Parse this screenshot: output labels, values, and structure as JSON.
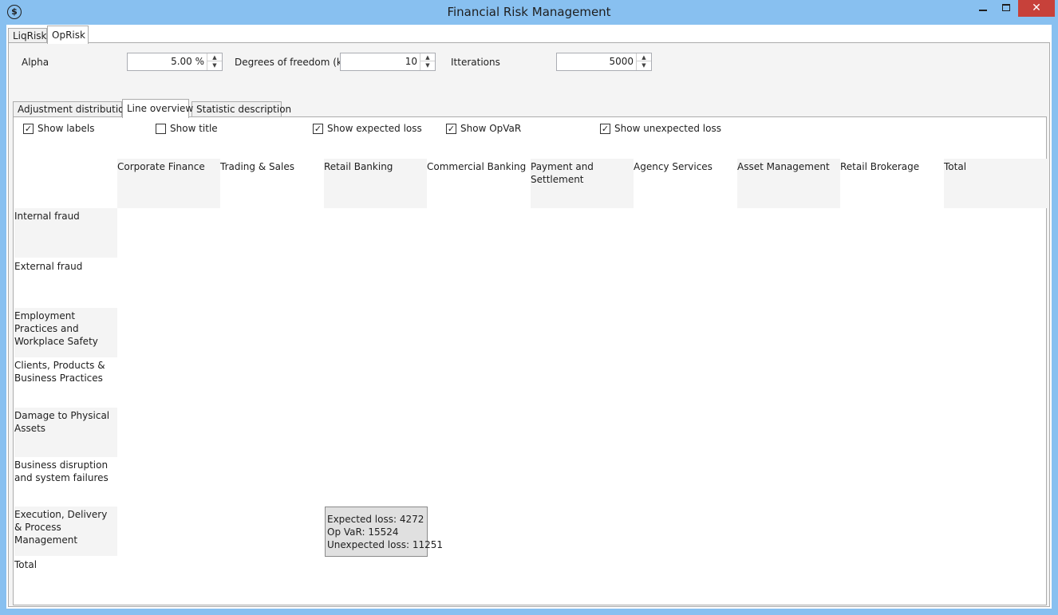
{
  "window": {
    "title": "Financial Risk Management",
    "icon": "dollar-circle-icon",
    "close_glyph": "✕"
  },
  "top_tabs": [
    {
      "label": "LiqRisk",
      "active": false
    },
    {
      "label": "OpRisk",
      "active": true
    }
  ],
  "params": {
    "alpha": {
      "label": "Alpha",
      "value": "5.00 %"
    },
    "dof": {
      "label": "Degrees of freedom (k)",
      "value": "10"
    },
    "iterations": {
      "label": "Itterations",
      "value": "5000"
    }
  },
  "inner_tabs": [
    {
      "label": "Adjustment distribution",
      "active": false
    },
    {
      "label": "Line overview",
      "active": true
    },
    {
      "label": "Statistic description",
      "active": false
    }
  ],
  "options": [
    {
      "label": "Show labels",
      "checked": true
    },
    {
      "label": "Show title",
      "checked": false
    },
    {
      "label": "Show expected loss",
      "checked": true
    },
    {
      "label": "Show OpVaR",
      "checked": true
    },
    {
      "label": "Show unexpected loss",
      "checked": true
    }
  ],
  "check_glyph": "✓",
  "columns": [
    "Corporate Finance",
    "Trading & Sales",
    "Retail Banking",
    "Commercial Banking",
    "Payment and Settlement",
    "Agency Services",
    "Asset Management",
    "Retail Brokerage",
    "Total"
  ],
  "rows": [
    "Internal fraud",
    "External fraud",
    "Employment Practices and Workplace Safety",
    "Clients, Products & Business Practices",
    "Damage to Physical Assets",
    "Business disruption and system failures",
    "Execution, Delivery & Process Management",
    "Total"
  ],
  "tooltip": {
    "expected": "Expected loss: 4272",
    "opvar": "Op VaR: 15524",
    "unexpected": "Unexpected loss: 11251"
  },
  "colors": {
    "titlebar": "#88c0f0",
    "close": "#c7413a",
    "cell_shade": "#f4f4f4",
    "tooltip_bg": "#e0e0e0"
  }
}
